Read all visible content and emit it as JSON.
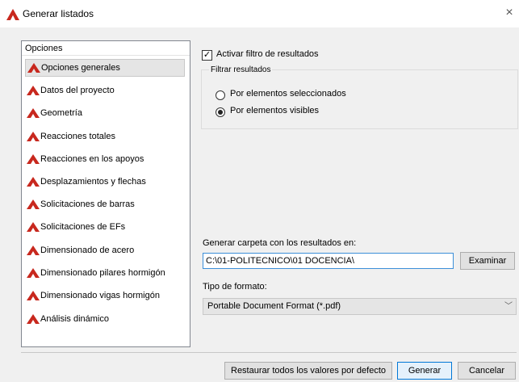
{
  "window": {
    "title": "Generar listados",
    "close_glyph": "×"
  },
  "left_panel": {
    "header": "Opciones",
    "items": [
      {
        "label": "Opciones generales",
        "selected": true
      },
      {
        "label": "Datos del proyecto"
      },
      {
        "label": "Geometría"
      },
      {
        "label": "Reacciones totales"
      },
      {
        "label": "Reacciones en los apoyos"
      },
      {
        "label": "Desplazamientos y flechas"
      },
      {
        "label": "Solicitaciones de barras"
      },
      {
        "label": "Solicitaciones de EFs"
      },
      {
        "label": "Dimensionado de acero"
      },
      {
        "label": "Dimensionado pilares hormigón"
      },
      {
        "label": "Dimensionado vigas hormigón"
      },
      {
        "label": "Análisis dinámico"
      }
    ]
  },
  "filter": {
    "checkbox_label": "Activar filtro de resultados",
    "checkbox_checked": true,
    "group_title": "Filtrar resultados",
    "radio_selected_elements": "Por elementos seleccionados",
    "radio_visible_elements": "Por elementos visibles",
    "selected_option": "visible"
  },
  "output": {
    "folder_label": "Generar carpeta con los resultados en:",
    "folder_value": "C:\\01-POLITECNICO\\01 DOCENCIA\\",
    "browse_label": "Examinar",
    "format_label": "Tipo de formato:",
    "format_value": "Portable Document Format (*.pdf)"
  },
  "buttons": {
    "restore": "Restaurar todos los valores por defecto",
    "generate": "Generar",
    "cancel": "Cancelar"
  },
  "colors": {
    "brand_icon": "#c8281e",
    "accent": "#0078d7"
  },
  "icons": {
    "app": "red-triangle-logo-icon",
    "item": "red-triangle-logo-icon",
    "close": "close-icon",
    "dropdown": "chevron-down-icon"
  }
}
